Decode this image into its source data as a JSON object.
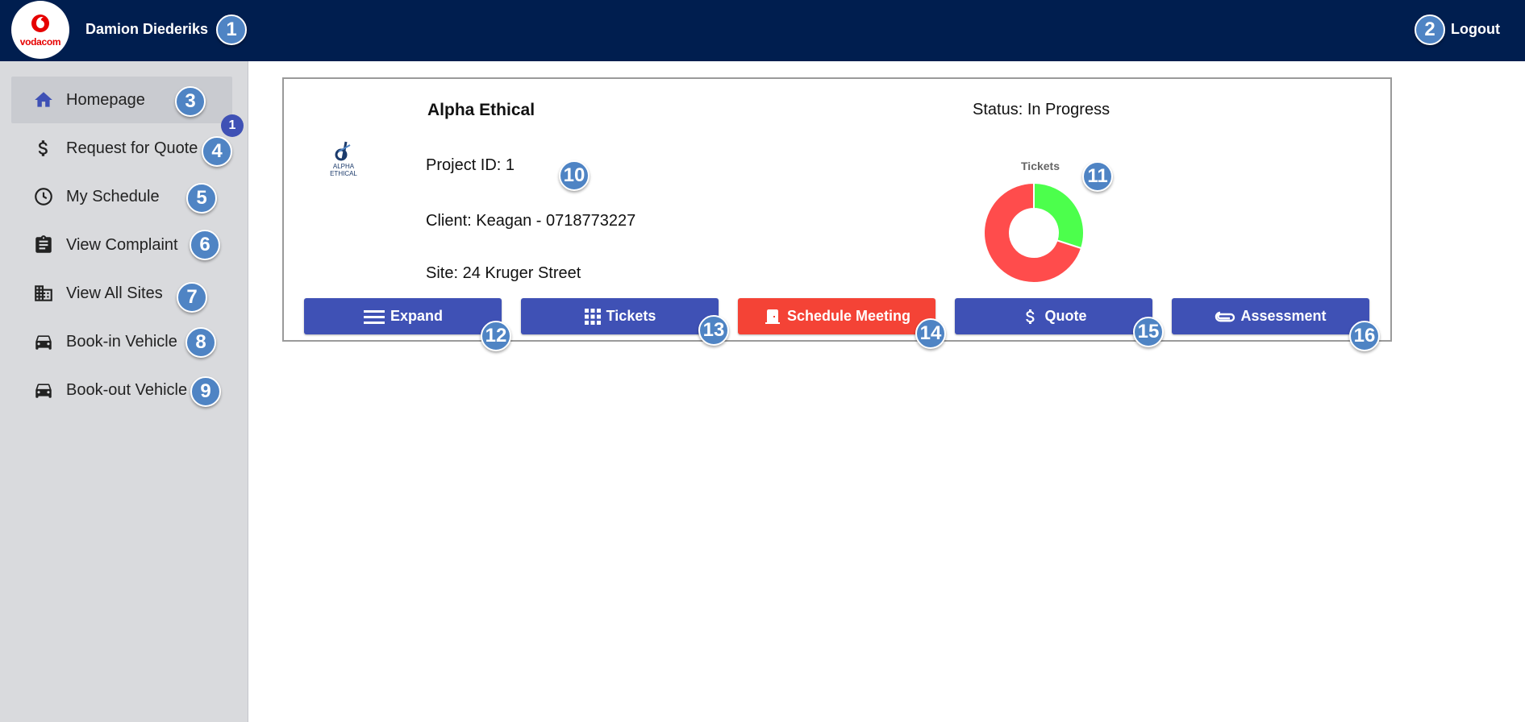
{
  "header": {
    "brand": "vodacom",
    "user_name": "Damion Diederiks",
    "logout_label": "Logout"
  },
  "sidebar": {
    "items": [
      {
        "label": "Homepage",
        "icon": "home-icon",
        "active": true
      },
      {
        "label": "Request for Quote",
        "icon": "dollar-icon"
      },
      {
        "label": "My Schedule",
        "icon": "clock-icon"
      },
      {
        "label": "View Complaint",
        "icon": "clipboard-icon"
      },
      {
        "label": "View All Sites",
        "icon": "building-icon"
      },
      {
        "label": "Book-in Vehicle",
        "icon": "car-icon"
      },
      {
        "label": "Book-out Vehicle",
        "icon": "car-icon"
      }
    ],
    "quote_badge": "1"
  },
  "project": {
    "logo_text": "ALPHA ETHICAL",
    "name": "Alpha Ethical",
    "project_id": "Project ID: 1",
    "client": "Client: Keagan - 0718773227",
    "site": "Site: 24 Kruger Street",
    "status": "Status: In Progress"
  },
  "chart_data": {
    "type": "pie",
    "title": "Tickets",
    "donut": true,
    "slices": [
      {
        "value": 30,
        "color": "#4cff4c"
      },
      {
        "value": 70,
        "color": "#ff4c4c"
      }
    ]
  },
  "buttons": [
    {
      "label": "Expand",
      "icon": "menu-icon",
      "color": "#3f51b5"
    },
    {
      "label": "Tickets",
      "icon": "grid-icon",
      "color": "#3f51b5"
    },
    {
      "label": "Schedule Meeting",
      "icon": "door-icon",
      "color": "#f44336"
    },
    {
      "label": "Quote",
      "icon": "dollar-icon",
      "color": "#3f51b5"
    },
    {
      "label": "Assessment",
      "icon": "paperclip-icon",
      "color": "#3f51b5"
    }
  ],
  "markers": [
    "1",
    "2",
    "3",
    "4",
    "5",
    "6",
    "7",
    "8",
    "9",
    "10",
    "11",
    "12",
    "13",
    "14",
    "15",
    "16"
  ]
}
